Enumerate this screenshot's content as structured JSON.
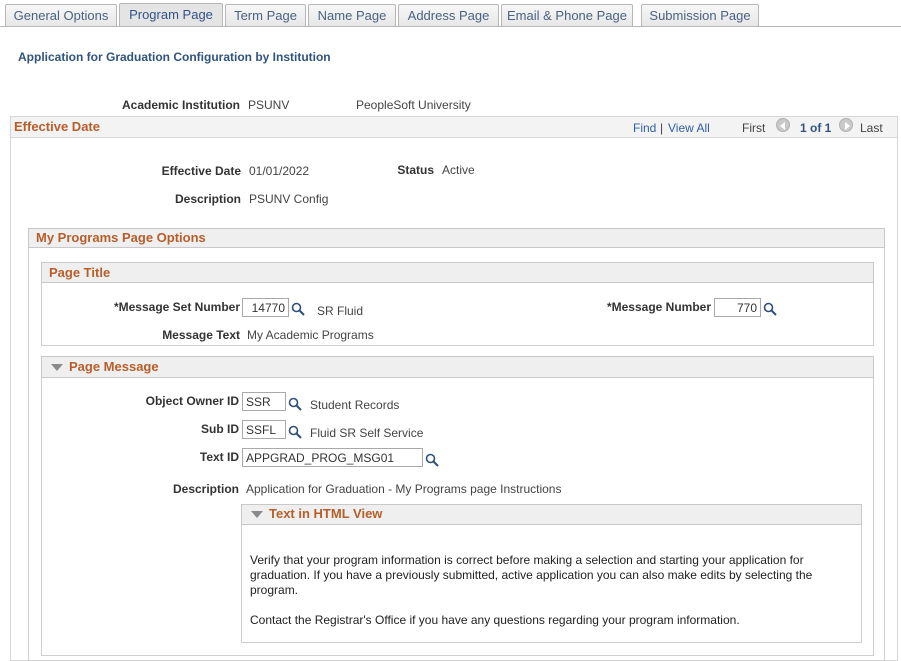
{
  "tabs": [
    {
      "label": "General Options"
    },
    {
      "label": "Program Page"
    },
    {
      "label": "Term Page"
    },
    {
      "label": "Name Page"
    },
    {
      "label": "Address Page"
    },
    {
      "label": "Email & Phone Page"
    },
    {
      "label": "Submission Page"
    }
  ],
  "page_title": "Application for Graduation Configuration by Institution",
  "institution": {
    "label": "Academic Institution",
    "code": "PSUNV",
    "name": "PeopleSoft University"
  },
  "effective_section": {
    "title": "Effective Date",
    "find": "Find",
    "separator": "|",
    "view_all": "View All",
    "first": "First",
    "counter": "1 of 1",
    "last": "Last"
  },
  "effective": {
    "date_label": "Effective Date",
    "date_value": "01/01/2022",
    "status_label": "Status",
    "status_value": "Active",
    "desc_label": "Description",
    "desc_value": "PSUNV Config"
  },
  "programs": {
    "title": "My Programs Page Options",
    "page_title_section": {
      "title": "Page Title",
      "msg_set_label": "*Message Set Number",
      "msg_set_value": "14770",
      "msg_set_desc": "SR Fluid",
      "msg_num_label": "*Message Number",
      "msg_num_value": "770",
      "msg_text_label": "Message Text",
      "msg_text_value": "My Academic Programs"
    },
    "page_message": {
      "title": "Page Message",
      "owner_label": "Object Owner ID",
      "owner_value": "SSR",
      "owner_desc": "Student Records",
      "sub_label": "Sub ID",
      "sub_value": "SSFL",
      "sub_desc": "Fluid SR Self Service",
      "text_id_label": "Text ID",
      "text_id_value": "APPGRAD_PROG_MSG01",
      "desc_label": "Description",
      "desc_value": "Application for Graduation - My Programs page Instructions",
      "html_view": {
        "title": "Text in HTML View",
        "para1": "Verify that your program information is correct before making a selection and starting your application for graduation. If you have a previously submitted, active application you can also make edits by selecting the program.",
        "para2": "Contact the Registrar's Office if you have any questions regarding your program information."
      }
    }
  },
  "icons": {
    "lookup": "magnifier-icon",
    "collapse": "triangle-down-icon",
    "prev": "prev-arrow-icon",
    "next": "next-arrow-icon"
  },
  "colors": {
    "section_title": "#b85e2a",
    "page_title": "#30547f",
    "link": "#2e5ea8",
    "tab_text": "#4b6283"
  }
}
